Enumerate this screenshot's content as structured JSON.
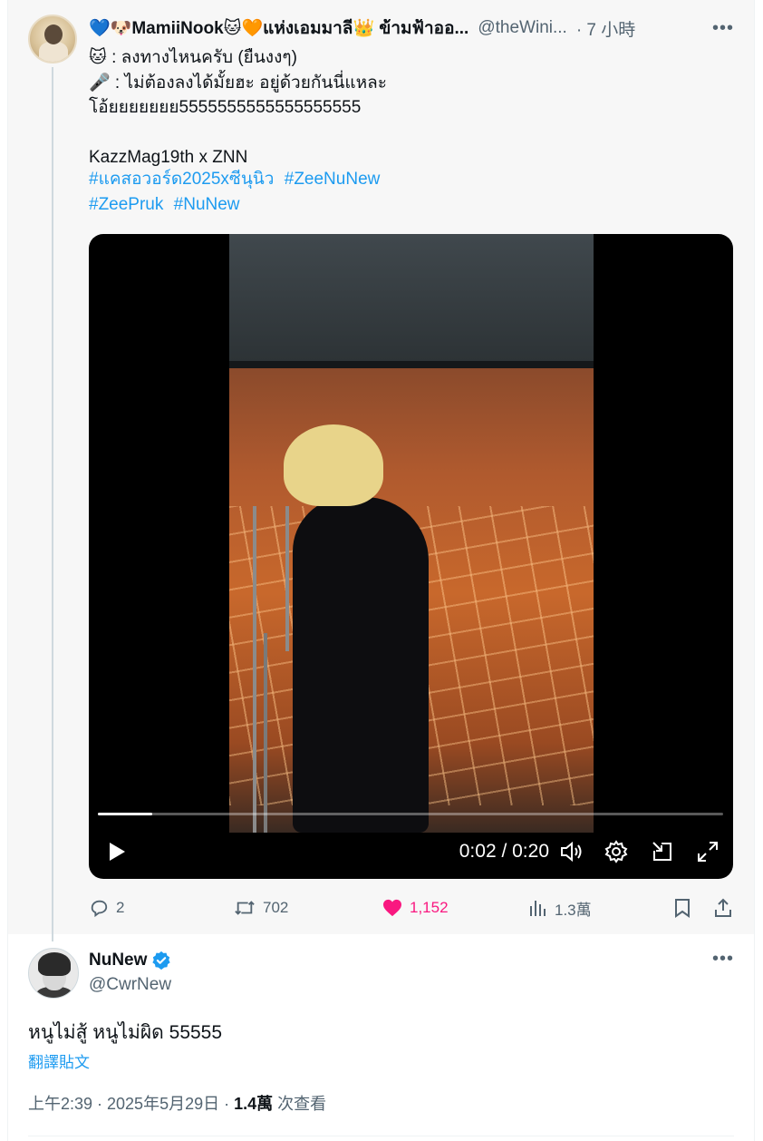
{
  "parent_tweet": {
    "display_name": "💙🐶MamiiNook🐱🧡แห่งเอมมาลี👑 ข้ามฟ้าออ...",
    "handle": "@theWini...",
    "time": "· 7 小時",
    "more_icon": "more-horizontal-icon",
    "lines": [
      "🐱 : ลงทางไหนครับ (ยืนงงๆ)",
      "🎤 : ไม่ต้องลงได้มั้ยฮะ อยู่ด้วยกันนี่แหละ",
      "โอ้ยยยยยยย5555555555555555555",
      "",
      "KazzMag19th x ZNN"
    ],
    "hashtags_line1": [
      "#แคสอวอร์ด2025xซีนุนิว",
      "#ZeeNuNew"
    ],
    "hashtags_line2": [
      "#ZeePruk",
      "#NuNew"
    ],
    "video": {
      "time_readout": "0:02 / 0:20",
      "progress_fraction": 0.087,
      "controls": [
        "play-icon",
        "volume-icon",
        "settings-gear-icon",
        "dock-icon",
        "fullscreen-icon"
      ]
    },
    "actions": {
      "reply_count": "2",
      "retweet_count": "702",
      "like_count": "1,152",
      "views_count": "1.3萬"
    },
    "colors": {
      "like": "#f91880",
      "link": "#1d9bf0",
      "secondary_text": "#536471"
    }
  },
  "main_tweet": {
    "display_name": "NuNew",
    "handle": "@CwrNew",
    "verified": true,
    "text": "หนูไม่สู้ หนูไม่ผิด 55555",
    "translate_label": "翻譯貼文",
    "timestamp": "上午2:39 · 2025年5月29日 · ",
    "views_number": "1.4萬",
    "views_suffix": " 次查看"
  }
}
